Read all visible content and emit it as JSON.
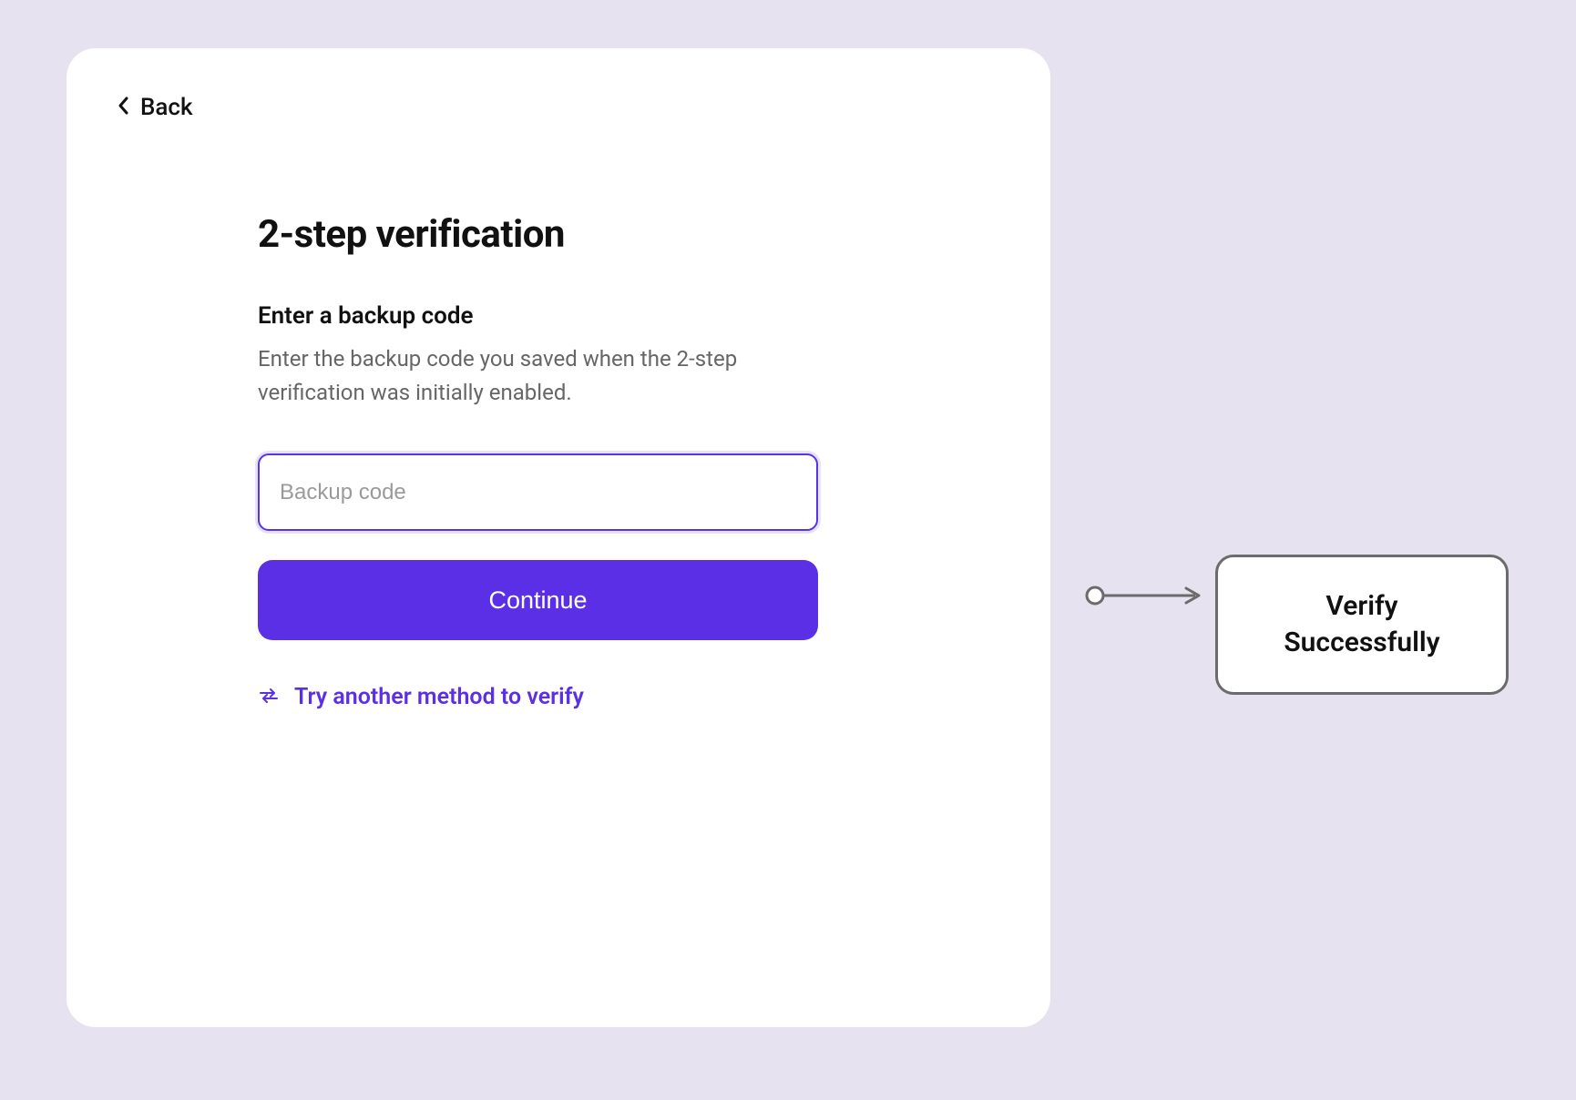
{
  "card": {
    "back_label": "Back",
    "title": "2-step verification",
    "subtitle": "Enter a backup code",
    "description": "Enter the backup code you saved when the 2-step verification was initially enabled.",
    "input_placeholder": "Backup code",
    "input_value": "",
    "continue_label": "Continue",
    "alt_method_label": "Try another method to verify"
  },
  "flow": {
    "result_label": "Verify\nSuccessfully"
  },
  "colors": {
    "accent": "#5b2fe6",
    "page_bg": "#e6e2f0",
    "card_bg": "#ffffff",
    "text_primary": "#111111",
    "text_secondary": "#666666",
    "flow_border": "#6b6b6b"
  }
}
